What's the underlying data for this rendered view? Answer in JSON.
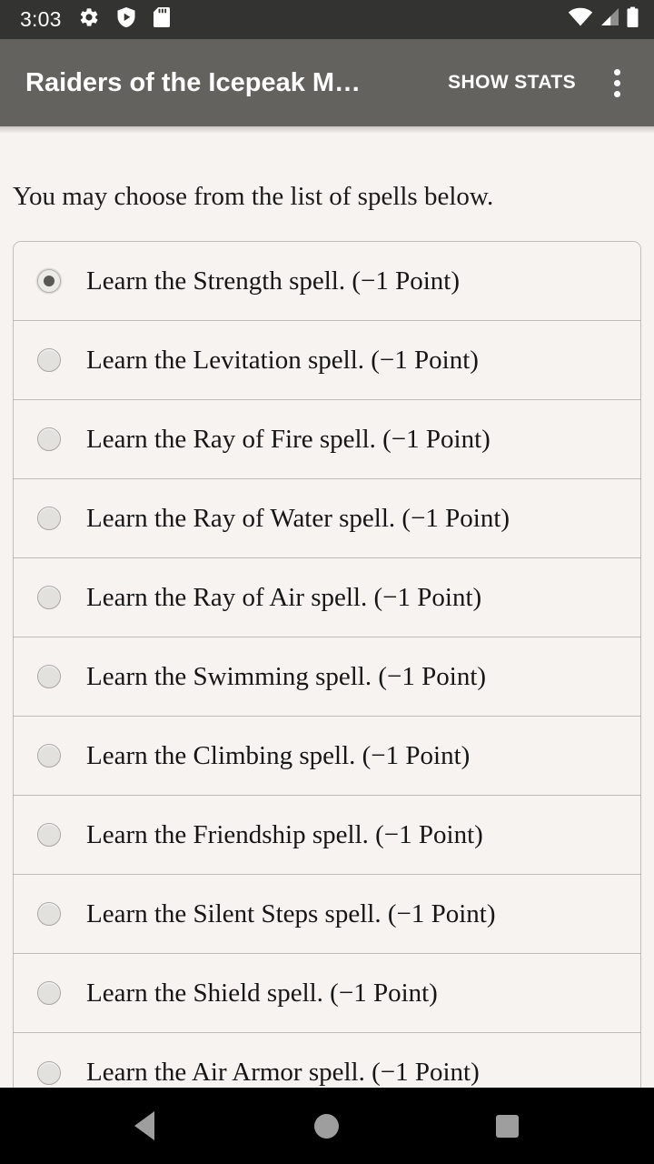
{
  "status_bar": {
    "clock": "3:03",
    "left_icons": [
      "gear-icon",
      "shield-play-icon",
      "sd-card-icon"
    ],
    "right_icons": [
      "wifi-icon",
      "cell-signal-icon",
      "battery-icon"
    ],
    "background_color": "#333331",
    "foreground_color": "#FFFFFF"
  },
  "app_bar": {
    "title": "Raiders of the Icepeak M…",
    "action_label": "SHOW STATS",
    "overflow_icon": "more-vert-icon",
    "background_color": "#63625F",
    "foreground_color": "#FFFFFF"
  },
  "content": {
    "prompt": "You may choose from the list of spells below.",
    "background_color": "#F7F3F1",
    "text_color": "#161616",
    "selected_index": 0,
    "spells": [
      {
        "label": "Learn the Strength spell. (−1 Point)",
        "selected": true
      },
      {
        "label": "Learn the Levitation spell. (−1 Point)",
        "selected": false
      },
      {
        "label": "Learn the Ray of Fire spell. (−1 Point)",
        "selected": false
      },
      {
        "label": "Learn the Ray of Water spell. (−1 Point)",
        "selected": false
      },
      {
        "label": "Learn the Ray of Air spell. (−1 Point)",
        "selected": false
      },
      {
        "label": "Learn the Swimming spell. (−1 Point)",
        "selected": false
      },
      {
        "label": "Learn the Climbing spell. (−1 Point)",
        "selected": false
      },
      {
        "label": "Learn the Friendship spell. (−1 Point)",
        "selected": false
      },
      {
        "label": "Learn the Silent Steps spell. (−1 Point)",
        "selected": false
      },
      {
        "label": "Learn the Shield spell. (−1 Point)",
        "selected": false
      },
      {
        "label": "Learn the Air Armor spell. (−1 Point)",
        "selected": false
      }
    ]
  },
  "nav_bar": {
    "background_color": "#000000",
    "icon_color": "#9E9E9E",
    "buttons": [
      "back-icon",
      "home-icon",
      "recents-icon"
    ]
  }
}
